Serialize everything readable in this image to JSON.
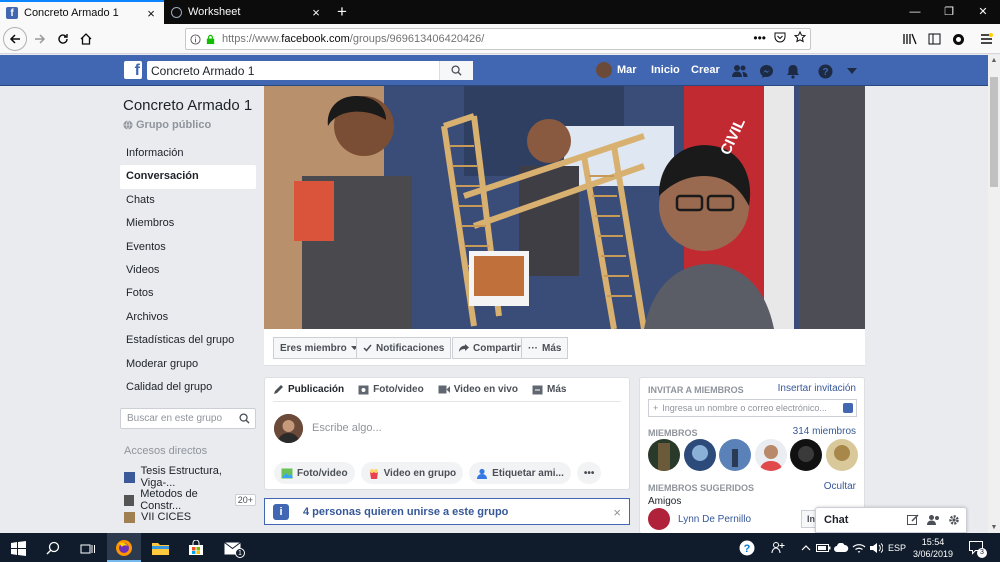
{
  "browser": {
    "tabs": [
      {
        "title": "Concreto Armado 1",
        "active": true
      },
      {
        "title": "Worksheet",
        "active": false
      }
    ],
    "url_prefix": "https://www.",
    "url_domain": "facebook.com",
    "url_path": "/groups/969613406420426/",
    "url_actions": "•••"
  },
  "fb": {
    "search_value": "Concreto Armado 1",
    "user_name": "Mar",
    "nav_home": "Inicio",
    "nav_create": "Crear",
    "brand_color": "#4267b2"
  },
  "group": {
    "title": "Concreto Armado 1",
    "privacy": "Grupo público",
    "nav": [
      "Información",
      "Conversación",
      "Chats",
      "Miembros",
      "Eventos",
      "Videos",
      "Fotos",
      "Archivos",
      "Estadísticas del grupo",
      "Moderar grupo",
      "Calidad del grupo"
    ],
    "active_nav": "Conversación",
    "search_placeholder": "Buscar en este grupo",
    "shortcuts_title": "Accesos directos",
    "shortcuts": [
      {
        "label": "Tesis Estructura, Viga-...",
        "badge": ""
      },
      {
        "label": "Metodos de Constr...",
        "badge": "20+"
      },
      {
        "label": "VII CICES",
        "badge": ""
      }
    ]
  },
  "cover_actions": {
    "member": "Eres miembro",
    "notifications": "Notificaciones",
    "share": "Compartir",
    "more": "Más"
  },
  "composer": {
    "tabs": [
      "Publicación",
      "Foto/video",
      "Video en vivo",
      "Más"
    ],
    "placeholder": "Escribe algo...",
    "pills": [
      "Foto/video",
      "Video en grupo",
      "Etiquetar ami...",
      "•••"
    ]
  },
  "notice": {
    "text": "4 personas quieren unirse a este grupo",
    "icon": "i",
    "close": "×"
  },
  "right_panel": {
    "invite_title": "INVITAR A MIEMBROS",
    "invite_link": "Insertar invitación",
    "invite_placeholder": "Ingresa un nombre o correo electrónico...",
    "members_title": "MIEMBROS",
    "members_count": "314 miembros",
    "suggested_title": "MIEMBROS SUGERIDOS",
    "suggested_hide": "Ocultar",
    "friends_label": "Amigos",
    "suggested_name": "Lynn De Pernillo",
    "suggested_button": "Invitar a m"
  },
  "chat": {
    "label": "Chat"
  },
  "taskbar": {
    "lang": "ESP",
    "time": "15:54",
    "date": "3/06/2019",
    "mail_badge": "1",
    "notif_badge": "3"
  }
}
